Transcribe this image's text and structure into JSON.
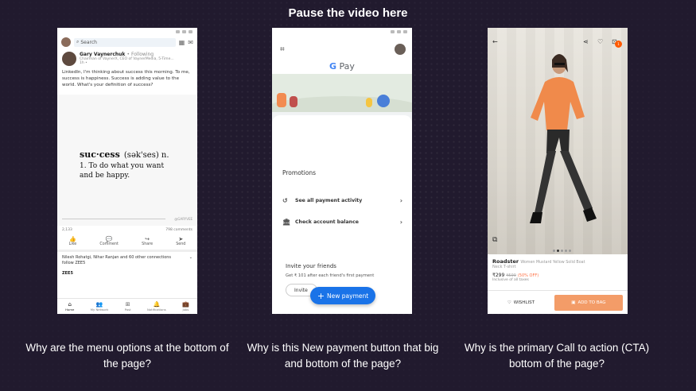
{
  "slide": {
    "title": "Pause the video here",
    "captions": [
      "Why are the menu options at the bottom of the page?",
      "Why is this New payment button that big and bottom of the page?",
      "Why is the primary Call to action (CTA) bottom of the page?"
    ]
  },
  "linkedin": {
    "search_placeholder": "Search",
    "author_name": "Gary Vaynerchuk",
    "follow_label": "• Following",
    "author_title": "Chairman of VaynerX, CEO of VaynerMedia, 5-Time...",
    "post_time": "1h •",
    "post_text": "LinkedIn, I'm thinking about success this morning. To me, success is happiness. Success is adding value to the world. What's your definition of success?",
    "dict_word": "suc·cess",
    "dict_phonetic": "(sək'ses) n.",
    "dict_definition": "1. To do what you want and be happy.",
    "watermark": "@GARYVEE",
    "reactions": "2,133",
    "comments": "798 comments",
    "actions": [
      "Like",
      "Comment",
      "Share",
      "Send"
    ],
    "connections_text": "Nilesh Rohatgi, Nihar Ranjan and 60 other connections follow ZEE5",
    "company": "ZEE5",
    "nav": [
      "Home",
      "My Network",
      "Post",
      "Notifications",
      "Jobs"
    ]
  },
  "gpay": {
    "logo_g": "G",
    "logo_pay": "Pay",
    "promotions": "Promotions",
    "row1": "See all payment activity",
    "row2": "Check account balance",
    "invite_title": "Invite your friends",
    "invite_sub": "Get ₹ 101 after each friend's first payment",
    "invite_button": "Invite",
    "new_payment": "New payment"
  },
  "fashion": {
    "badge": "1",
    "brand": "Roadster",
    "description": "Women Mustard Yellow Solid Boat",
    "sub": "Neck T-shirt",
    "price": "₹299",
    "old_price": "₹599",
    "discount": "(50% OFF)",
    "tax": "Inclusive of all taxes",
    "wishlist": "WISHLIST",
    "add_to_bag": "ADD TO BAG"
  }
}
